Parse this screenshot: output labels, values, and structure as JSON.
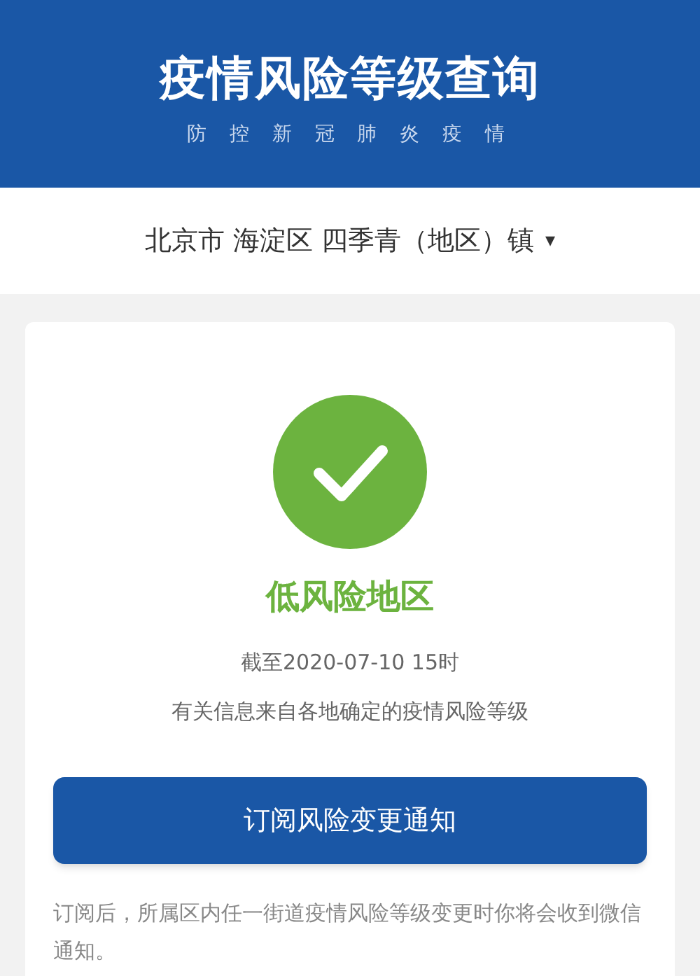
{
  "header": {
    "title": "疫情风险等级查询",
    "subtitle": "防 控 新 冠 肺 炎 疫 情"
  },
  "location": {
    "value": "北京市 海淀区 四季青（地区）镇",
    "dropdown": "▾"
  },
  "result": {
    "label": "低风险地区",
    "color": "#6cb33f",
    "updated": "截至2020-07-10 15时",
    "source": "有关信息来自各地确定的疫情风险等级"
  },
  "subscribe_button": "订阅风险变更通知",
  "note": "订阅后，所属区内任一街道疫情风险等级变更时你将会收到微信通知。"
}
